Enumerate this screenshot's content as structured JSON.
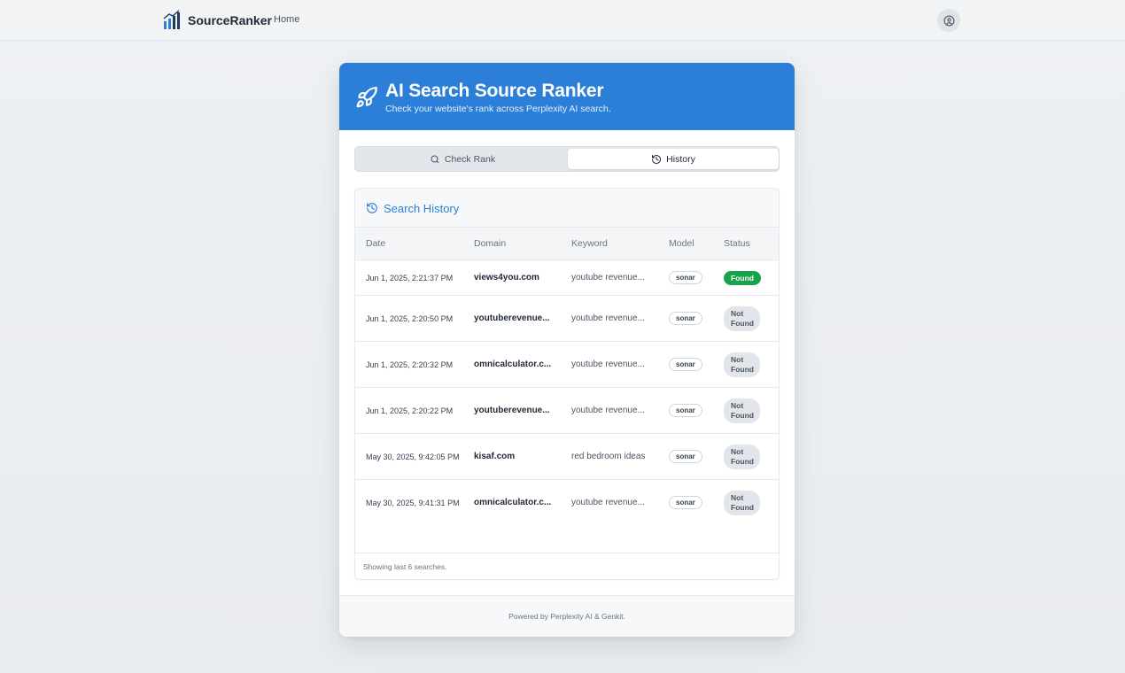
{
  "nav": {
    "brand": "SourceRanker",
    "home_label": "Home",
    "icons": {
      "brand": "bar-chart-icon",
      "account": "user-circle-icon"
    }
  },
  "header": {
    "title": "AI Search Source Ranker",
    "subtitle": "Check your website's rank across Perplexity AI search.",
    "icon": "rocket-icon",
    "background_color": "#2b7fd8"
  },
  "tabs": [
    {
      "label": "Check Rank",
      "icon": "search-icon",
      "active": false
    },
    {
      "label": "History",
      "icon": "history-icon",
      "active": true
    }
  ],
  "history": {
    "title": "Search History",
    "columns": [
      "Date",
      "Domain",
      "Keyword",
      "Model",
      "Status"
    ],
    "rows": [
      {
        "date": "Jun 1, 2025, 2:21:37 PM",
        "domain": "views4you.com",
        "keyword": "youtube revenue...",
        "model": "sonar",
        "status": "Found"
      },
      {
        "date": "Jun 1, 2025, 2:20:50 PM",
        "domain": "youtuberevenue...",
        "keyword": "youtube revenue...",
        "model": "sonar",
        "status_line1": "Not",
        "status_line2": "Found"
      },
      {
        "date": "Jun 1, 2025, 2:20:32 PM",
        "domain": "omnicalculator.c...",
        "keyword": "youtube revenue...",
        "model": "sonar",
        "status_line1": "Not",
        "status_line2": "Found"
      },
      {
        "date": "Jun 1, 2025, 2:20:22 PM",
        "domain": "youtuberevenue...",
        "keyword": "youtube revenue...",
        "model": "sonar",
        "status_line1": "Not",
        "status_line2": "Found"
      },
      {
        "date": "May 30, 2025, 9:42:05 PM",
        "domain": "kisaf.com",
        "keyword": "red bedroom ideas",
        "model": "sonar",
        "status_line1": "Not",
        "status_line2": "Found"
      },
      {
        "date": "May 30, 2025, 9:41:31 PM",
        "domain": "omnicalculator.c...",
        "keyword": "youtube revenue...",
        "model": "sonar",
        "status_line1": "Not",
        "status_line2": "Found"
      }
    ],
    "footer": "Showing last 6 searches."
  },
  "footer": {
    "powered_by": "Powered by Perplexity AI & Genkit."
  },
  "colors": {
    "accent": "#2b7fd8",
    "found": "#16a34a",
    "not_found_bg": "#e2e6eb"
  }
}
